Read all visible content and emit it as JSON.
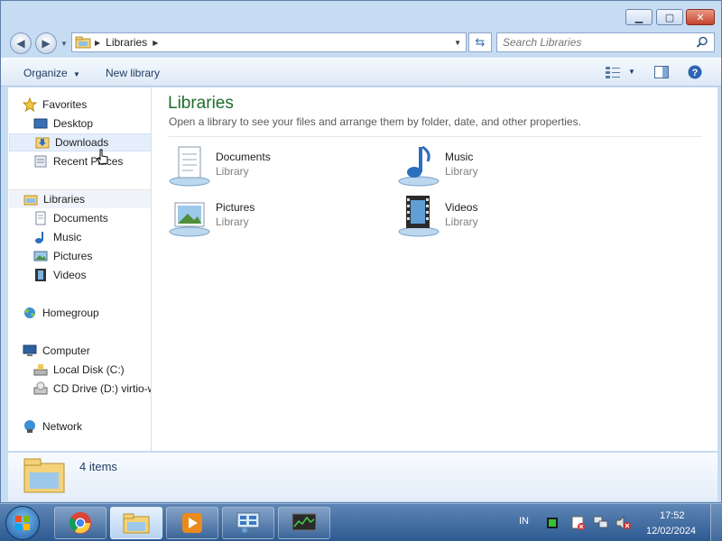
{
  "window": {
    "min_glyph": "▁",
    "max_glyph": "▢",
    "close_glyph": "✕"
  },
  "address": {
    "path": "Libraries",
    "search_placeholder": "Search Libraries"
  },
  "toolbar": {
    "organize": "Organize",
    "new_library": "New library"
  },
  "nav": {
    "favorites": "Favorites",
    "desktop": "Desktop",
    "downloads": "Downloads",
    "recent_places": "Recent Places",
    "libraries": "Libraries",
    "documents": "Documents",
    "music": "Music",
    "pictures": "Pictures",
    "videos": "Videos",
    "homegroup": "Homegroup",
    "computer": "Computer",
    "local_disk": "Local Disk (C:)",
    "cd_drive": "CD Drive (D:) virtio-w",
    "network": "Network"
  },
  "content": {
    "title": "Libraries",
    "subtitle": "Open a library to see your files and arrange them by folder, date, and other properties.",
    "items": [
      {
        "name": "Documents",
        "type": "Library"
      },
      {
        "name": "Music",
        "type": "Library"
      },
      {
        "name": "Pictures",
        "type": "Library"
      },
      {
        "name": "Videos",
        "type": "Library"
      }
    ]
  },
  "details": {
    "count": "4 items"
  },
  "taskbar": {
    "lang": "IN",
    "time": "17:52",
    "date": "12/02/2024"
  },
  "colors": {
    "title_green": "#1e6e2e",
    "taskbar_blue": "#2d5a92",
    "selection": "#e5eefb"
  }
}
